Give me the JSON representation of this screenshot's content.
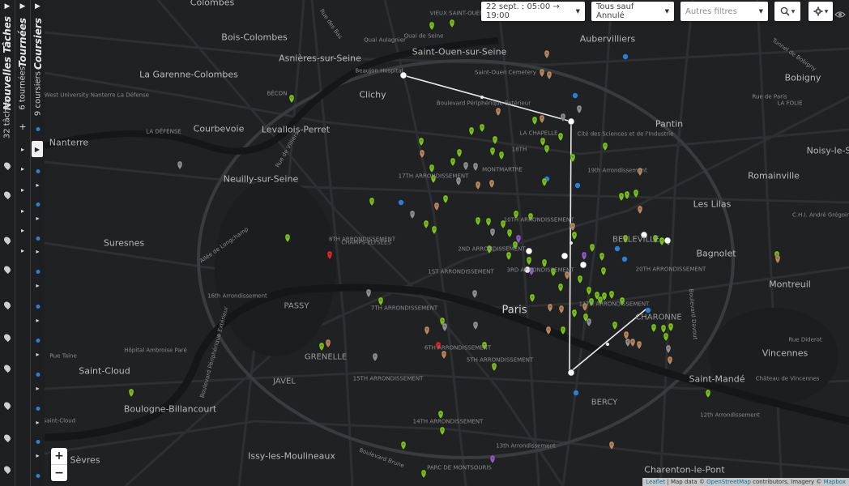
{
  "panels": {
    "nouvelles_taches": {
      "title": "Nouvelles Tâches",
      "count": "32 tâches"
    },
    "tournees": {
      "title": "Tournées",
      "count": "6 tournées"
    },
    "coursiers": {
      "title": "Coursiers",
      "count": "9 coursiers"
    },
    "expand_glyph": "▶",
    "row_glyph": "▸"
  },
  "toolbar": {
    "date_filter": "22 sept. : 05:00 → 19:00",
    "status_filter": "Tous sauf Annulé",
    "other_filters_placeholder": "Autres filtres",
    "search_icon": "search-icon",
    "settings_icon": "gear-icon",
    "visibility_icon": "eye-icon"
  },
  "zoom": {
    "in": "+",
    "out": "−"
  },
  "attribution": {
    "leaflet": "Leaflet",
    "text1": " | Map data © ",
    "osm": "OpenStreetMap",
    "text2": " contributors, Imagery © ",
    "mapbox": "Mapbox"
  },
  "colors": {
    "green": "#7cc21e",
    "tan": "#b9875f",
    "grey": "#8f8f8f",
    "purple": "#8e5bc4",
    "red": "#d92a2a",
    "blue": "#2a7fd6",
    "route": "#e8e8e8"
  },
  "map_labels": {
    "clichy": "Clichy",
    "paris": "Paris",
    "nanterre": "Nanterre",
    "suresnes": "Suresnes",
    "pantin": "Pantin",
    "bagnolet": "Bagnolet",
    "montreuil": "Montreuil",
    "vincennes": "Vincennes",
    "romainville": "Romainville",
    "les_lilas": "Les Lilas",
    "bobigny": "Bobigny",
    "aubervilliers": "Aubervilliers",
    "saint_ouen": "Saint-Ouen-sur-Seine",
    "asnieres": "Asnières-sur-Seine",
    "bois_colombes": "Bois-Colombes",
    "colombes": "Colombes",
    "la_garenne": "La Garenne-Colombes",
    "courbevoie": "Courbevoie",
    "levallois": "Levallois-Perret",
    "neuilly": "Neuilly-sur-Seine",
    "saint_cloud": "Saint-Cloud",
    "boulogne": "Boulogne-Billancourt",
    "issy": "Issy-les-Moulineaux",
    "sevres": "Sèvres",
    "saint_mande": "Saint-Mandé",
    "charenton": "Charenton-le-Pont",
    "noisy": "Noisy-le-S",
    "belleville": "BELLEVILLE",
    "passy": "PASSY",
    "grenelle": "GRENELLE",
    "javel": "JAVEL",
    "bercy": "BERCY",
    "charonne": "CHARONNE",
    "arr_16": "16th Arrondissement",
    "arr_19": "19th Arrondissement",
    "arr_12": "12th Arrondissement",
    "arr_13": "13th Arrondissement",
    "arr_20": "20TH ARRONDISSEMENT",
    "arr_14": "14TH ARRONDISSEMENT",
    "arr_15": "15TH ARRONDISSEMENT",
    "arr_17": "17TH ARRONDISSEMENT",
    "arr_8": "8TH ARRONDISSEMENT",
    "arr_7": "7TH ARRONDISSEMENT",
    "arr_6": "6TH ARRONDISSEMENT",
    "arr_5": "5TH ARRONDISSEMENT",
    "arr_1": "1ST ARRONDISSEMENT",
    "arr_2": "2ND ARRONDISSEMENT",
    "arr_3": "3RD ARRONDISSEMENT",
    "arr_10": "10TH ARRONDISSEMENT",
    "arr_11": "11TH ARRONDISSEMENT",
    "arr_18": "18TH",
    "champs": "CHAMPS-ÉLYSÉES",
    "montmartre": "MONTMARTRE",
    "la_chapelle": "LA CHAPELLE",
    "beaujon": "Beaujon Hospital",
    "saint_ouen_cemetery": "Saint-Ouen Cemetery",
    "cite_sciences": "Cité des Sciences et de l'Industrie",
    "bd_peripherique": "Boulevard Périphérique Extérieur",
    "longchamp": "Allée de Longchamp",
    "rue_taine": "Rue Taine",
    "hopital_ambroise": "Hôpital Ambroise Paré",
    "saint_cloud_small": "Saint-Cloud",
    "paris_west": "Paris West University Nanterre La Défense",
    "la_defense": "LA DÉFENSE",
    "bd_davout": "Boulevard Davout",
    "chateau_vincennes": "Château de Vincennes",
    "quai_aulagnier": "Quai Aulagnier",
    "tunnel_bobigny": "Tunnel de Bobigny",
    "rue_de_paris": "Rue de Paris",
    "chra": "C.H.I. André Grégoire",
    "la_folie": "LA FOLIE",
    "vieux_saint_ouen": "VIEUX SAINT-OUEN",
    "parc_montsouris": "PARC DE MONTSOURIS",
    "quai_seine": "Quai de Seine",
    "rue_de_villiers": "Rue de Villiers",
    "rue_des_bas": "Rue des Bas",
    "rue_diderot": "Rue Diderot",
    "bd_brune": "Boulevard Brune",
    "becon": "BÉCON"
  }
}
